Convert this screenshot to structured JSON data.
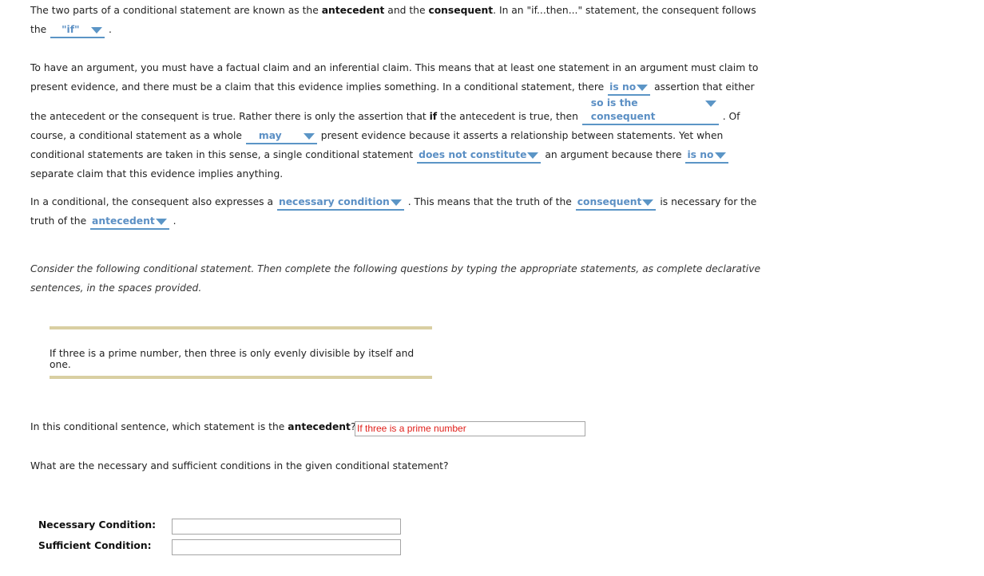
{
  "paragraph1": {
    "text_a": "The two parts of a conditional statement are known as the ",
    "bold_antecedent": "antecedent",
    "text_b": " and the ",
    "bold_consequent": "consequent",
    "text_c": ". In an \"if...then...\" statement, the consequent follows the ",
    "dropdown1": "\"if\"",
    "text_d": " ."
  },
  "paragraph2": {
    "text_a": "To have an argument, you must have a factual claim and an inferential claim. This means that at least one statement in an argument must claim to present evidence, and there must be a claim that this evidence implies something. In a conditional statement, there ",
    "dropdown1": "is no",
    "text_b": "  assertion that either the antecedent or the consequent is true. Rather there is only the assertion that ",
    "bold_if": "if",
    "text_c": " the antecedent is true, then ",
    "dropdown2": "so is the consequent",
    "text_d": " . Of course, a conditional statement as a whole ",
    "dropdown3": "may",
    "text_e": " present evidence because it asserts a relationship between statements. Yet when conditional statements are taken in this sense, a single conditional statement ",
    "dropdown4": "does not constitute",
    "text_f": "  an argument because there ",
    "dropdown5": "is no",
    "text_g": "  separate claim that this evidence implies anything."
  },
  "paragraph3": {
    "text_a": "In a conditional, the consequent also expresses a ",
    "dropdown1": "necessary condition",
    "text_b": " . This means that the truth of the ",
    "dropdown2": "consequent",
    "text_c": "  is necessary for the truth of the ",
    "dropdown3": "antecedent",
    "text_d": " ."
  },
  "instructions": "Consider the following conditional statement. Then complete the following questions by typing the appropriate statements, as complete declarative sentences, in the spaces provided.",
  "statement": "If three is a prime number, then three is only evenly divisible by itself and one.",
  "question1": {
    "text_a": "In this conditional sentence, which statement is the ",
    "bold": "antecedent",
    "text_b": "?",
    "answer": "If three is a prime number"
  },
  "question2": "What are the necessary and sufficient conditions in the given conditional statement?",
  "conditions": {
    "necessary_label": "Necessary Condition:",
    "necessary_value": "",
    "sufficient_label": "Sufficient Condition:",
    "sufficient_value": ""
  },
  "colors": {
    "dropdown_text": "#5b8fc4",
    "answer_text": "#e0201b",
    "rule": "#d9cfa2"
  }
}
